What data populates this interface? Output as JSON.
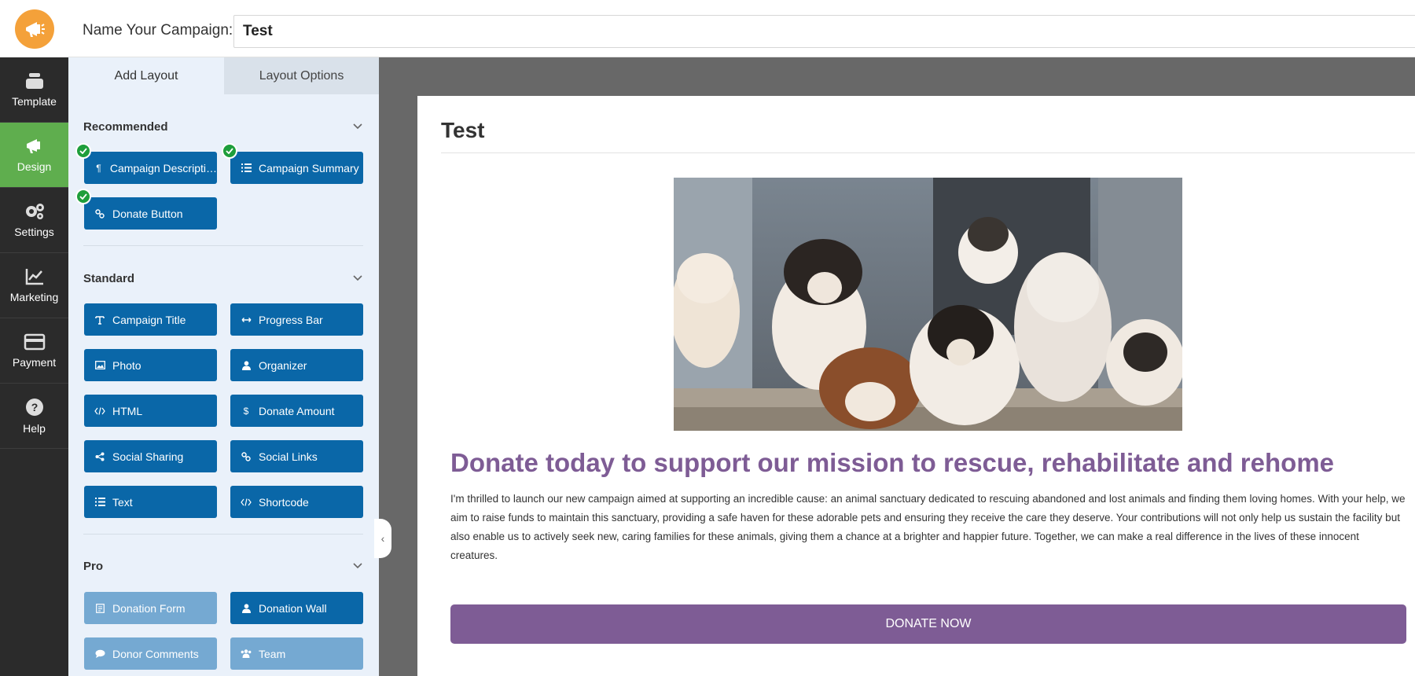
{
  "rail": {
    "items": [
      {
        "label": "Template",
        "icon": "template-icon"
      },
      {
        "label": "Design",
        "icon": "megaphone-icon"
      },
      {
        "label": "Settings",
        "icon": "gears-icon"
      },
      {
        "label": "Marketing",
        "icon": "chart-icon"
      },
      {
        "label": "Payment",
        "icon": "card-icon"
      },
      {
        "label": "Help",
        "icon": "help-icon"
      }
    ],
    "active": "Design",
    "active_color": "#5fae4e"
  },
  "topbar": {
    "label": "Name Your Campaign:",
    "campaign_name": "Test"
  },
  "panel": {
    "tabs": [
      "Add Layout",
      "Layout Options"
    ],
    "active_tab": "Add Layout",
    "sections": {
      "recommended": {
        "title": "Recommended",
        "blocks": [
          "Campaign Descripti…",
          "Campaign Summary",
          "Donate Button"
        ]
      },
      "standard": {
        "title": "Standard",
        "blocks": [
          "Campaign Title",
          "Progress Bar",
          "Photo",
          "Organizer",
          "HTML",
          "Donate Amount",
          "Social Sharing",
          "Social Links",
          "Text",
          "Shortcode"
        ]
      },
      "pro": {
        "title": "Pro",
        "blocks": [
          "Donation Form",
          "Donation Wall",
          "Donor Comments",
          "Team"
        ]
      }
    },
    "block_color": "#0a67a8"
  },
  "preview": {
    "title": "Test",
    "headline": "Donate today to support our mission to rescue, rehabilitate and rehome",
    "body": "I'm thrilled to launch our new campaign aimed at supporting an incredible cause: an animal sanctuary dedicated to rescuing abandoned and lost animals and finding them loving homes. With your help, we aim to raise funds to maintain this sanctuary, providing a safe haven for these adorable pets and ensuring they receive the care they deserve. Your contributions will not only help us sustain the facility but also enable us to actively seek new, caring families for these animals, giving them a chance at a brighter and happier future. Together, we can make a real difference in the lives of these innocent creatures.",
    "button": "DONATE NOW",
    "accent_color": "#7e5c95"
  }
}
